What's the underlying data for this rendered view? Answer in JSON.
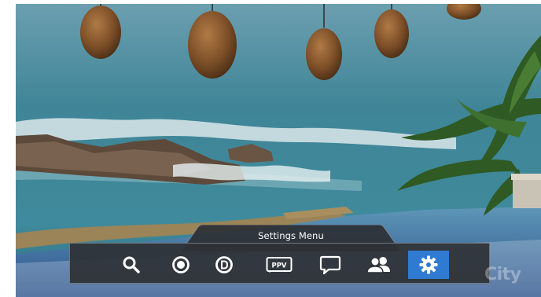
{
  "menu": {
    "title": "Settings Menu",
    "items": [
      {
        "id": "search",
        "icon": "search-icon",
        "selected": false
      },
      {
        "id": "record",
        "icon": "record-icon",
        "selected": false
      },
      {
        "id": "dvr",
        "icon": "dvr-d-icon",
        "selected": false
      },
      {
        "id": "ppv",
        "icon": "ppv-icon",
        "label": "PPV",
        "selected": false
      },
      {
        "id": "messages",
        "icon": "message-bubble-icon",
        "selected": false
      },
      {
        "id": "profiles",
        "icon": "users-icon",
        "selected": false
      },
      {
        "id": "settings",
        "icon": "gear-icon",
        "selected": true
      }
    ]
  },
  "watermark": {
    "text": "City"
  },
  "colors": {
    "selected": "#2f7bd2",
    "bar": "#2e3136",
    "icon": "#ffffff"
  }
}
